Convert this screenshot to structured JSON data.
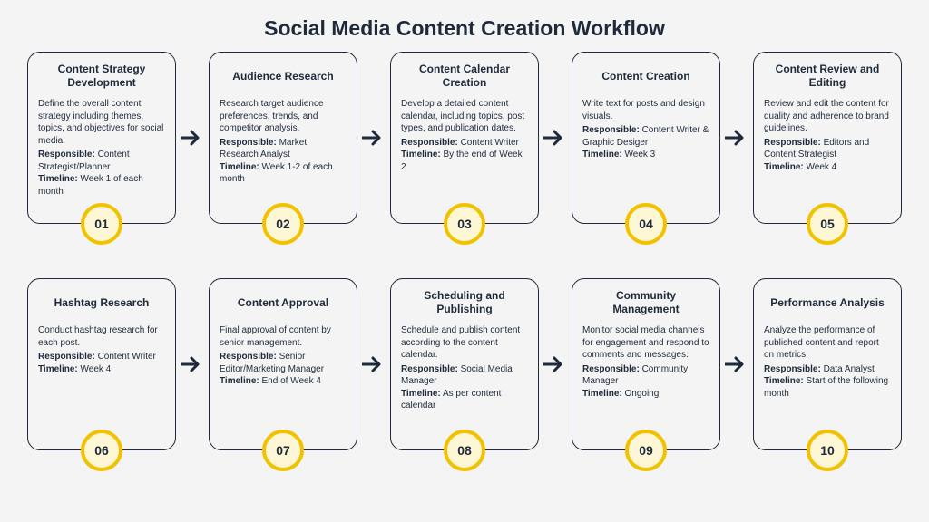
{
  "title": "Social Media Content Creation Workflow",
  "labels": {
    "responsible": "Responsible:",
    "timeline": "Timeline:"
  },
  "steps": [
    {
      "num": "01",
      "title": "Content Strategy Development",
      "desc": "Define the overall content strategy including themes, topics, and objectives for social media.",
      "responsible": "Content Strategist/Planner",
      "timeline": "Week 1 of each month"
    },
    {
      "num": "02",
      "title": "Audience Research",
      "desc": "Research target audience preferences, trends, and competitor analysis.",
      "responsible": "Market Research Analyst",
      "timeline": "Week 1-2 of each month"
    },
    {
      "num": "03",
      "title": "Content Calendar Creation",
      "desc": "Develop a detailed content calendar, including topics, post types, and publication dates.",
      "responsible": "Content Writer",
      "timeline": "By the end of Week 2"
    },
    {
      "num": "04",
      "title": "Content Creation",
      "desc": "Write text for posts and design visuals.",
      "responsible": "Content Writer & Graphic Desiger",
      "timeline": "Week 3"
    },
    {
      "num": "05",
      "title": "Content Review and Editing",
      "desc": "Review and edit the content for quality and adherence to brand guidelines.",
      "responsible": "Editors and Content Strategist",
      "timeline": "Week 4"
    },
    {
      "num": "06",
      "title": "Hashtag Research",
      "desc": "Conduct hashtag research for each post.",
      "responsible": "Content Writer",
      "timeline": "Week 4"
    },
    {
      "num": "07",
      "title": "Content Approval",
      "desc": "Final approval of content by senior management.",
      "responsible": "Senior Editor/Marketing Manager",
      "timeline": "End of Week 4"
    },
    {
      "num": "08",
      "title": "Scheduling and Publishing",
      "desc": "Schedule and publish content according to the content calendar.",
      "responsible": "Social Media Manager",
      "timeline": "As per content calendar"
    },
    {
      "num": "09",
      "title": "Community Management",
      "desc": "Monitor social media channels for engagement and respond to comments and messages.",
      "responsible": "Community Manager",
      "timeline": "Ongoing"
    },
    {
      "num": "10",
      "title": "Performance Analysis",
      "desc": "Analyze the performance of published content and report on metrics.",
      "responsible": "Data Analyst",
      "timeline": "Start of the following month"
    }
  ]
}
